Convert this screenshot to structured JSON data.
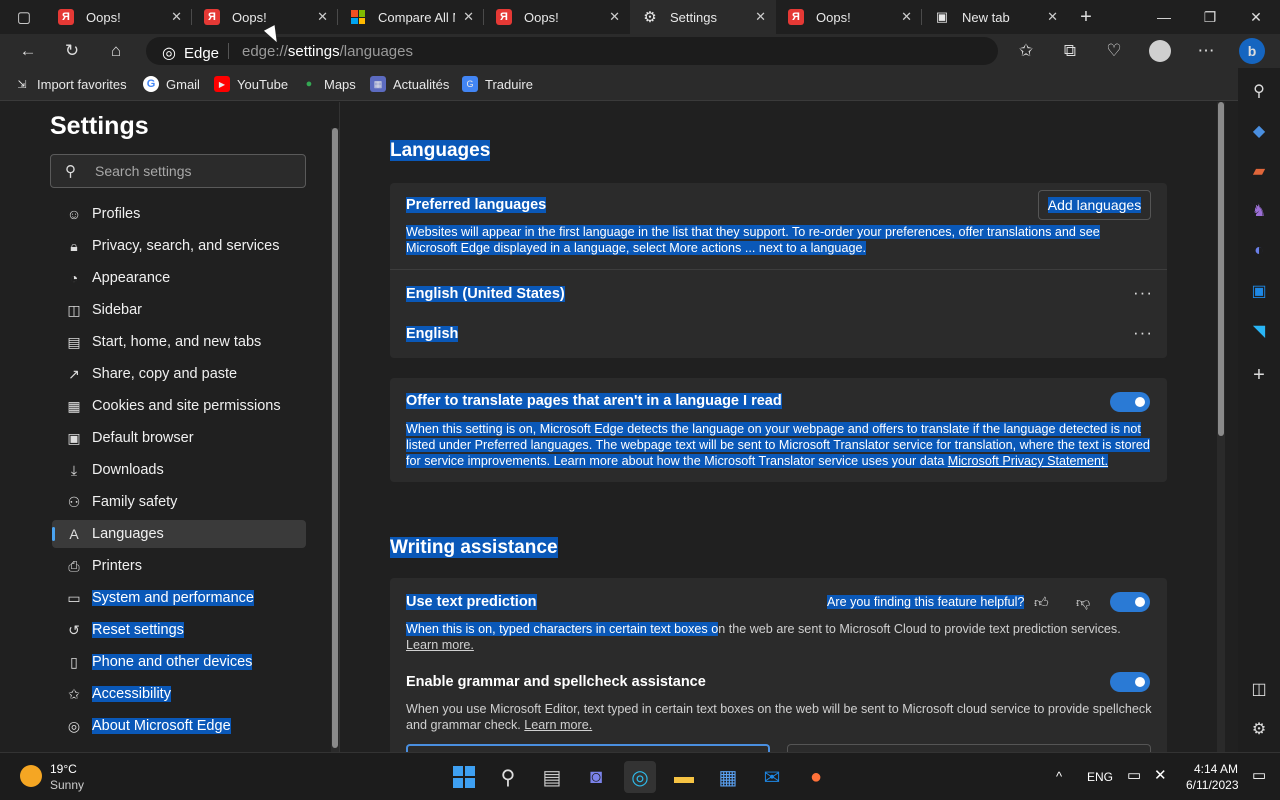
{
  "tabs": [
    {
      "title": "Oops!",
      "favicon": "yandex-icon"
    },
    {
      "title": "Oops!",
      "favicon": "yandex-icon"
    },
    {
      "title": "Compare All M",
      "favicon": "microsoft-icon"
    },
    {
      "title": "Oops!",
      "favicon": "yandex-icon"
    },
    {
      "title": "Settings",
      "favicon": "gear-icon"
    },
    {
      "title": "Oops!",
      "favicon": "yandex-icon"
    },
    {
      "title": "New tab",
      "favicon": "newtab-icon"
    }
  ],
  "address": {
    "browser_label": "Edge",
    "url_prefix": "edge://",
    "url_host": "settings",
    "url_path": "/languages"
  },
  "bookmarks": [
    {
      "label": "Import favorites",
      "icon": "import-icon"
    },
    {
      "label": "Gmail",
      "icon": "google-icon"
    },
    {
      "label": "YouTube",
      "icon": "youtube-icon"
    },
    {
      "label": "Maps",
      "icon": "maps-pin-icon"
    },
    {
      "label": "Actualités",
      "icon": "news-icon"
    },
    {
      "label": "Traduire",
      "icon": "translate-icon"
    }
  ],
  "settings": {
    "title": "Settings",
    "search_placeholder": "Search settings",
    "nav": [
      {
        "label": "Profiles",
        "icon": "profile-icon"
      },
      {
        "label": "Privacy, search, and services",
        "icon": "lock-icon"
      },
      {
        "label": "Appearance",
        "icon": "appearance-icon"
      },
      {
        "label": "Sidebar",
        "icon": "sidebar-icon"
      },
      {
        "label": "Start, home, and new tabs",
        "icon": "home-icon"
      },
      {
        "label": "Share, copy and paste",
        "icon": "share-icon"
      },
      {
        "label": "Cookies and site permissions",
        "icon": "cookies-icon"
      },
      {
        "label": "Default browser",
        "icon": "browser-icon"
      },
      {
        "label": "Downloads",
        "icon": "download-icon"
      },
      {
        "label": "Family safety",
        "icon": "family-icon"
      },
      {
        "label": "Languages",
        "icon": "languages-icon"
      },
      {
        "label": "Printers",
        "icon": "printer-icon"
      },
      {
        "label": "System and performance",
        "icon": "laptop-icon"
      },
      {
        "label": "Reset settings",
        "icon": "reset-icon"
      },
      {
        "label": "Phone and other devices",
        "icon": "phone-icon"
      },
      {
        "label": "Accessibility",
        "icon": "accessibility-icon"
      },
      {
        "label": "About Microsoft Edge",
        "icon": "edge-icon"
      }
    ]
  },
  "main": {
    "languages_heading": "Languages",
    "preferred_label": "Preferred languages",
    "add_languages": "Add languages",
    "preferred_desc": "Websites will appear in the first language in the list that they support. To re-order your preferences, offer translations and see Microsoft Edge displayed in a language, select More actions ... next to a language.",
    "lang_items": [
      "English (United States)",
      "English"
    ],
    "more_actions": "···",
    "translate_label": "Offer to translate pages that aren't in a language I read",
    "translate_desc": "When this setting is on, Microsoft Edge detects the language on your webpage and offers to translate if the language detected is not listed under Preferred languages. The webpage text will be sent to Microsoft Translator service for translation, where the text is stored for service improvements. Learn more about how the Microsoft Translator service uses your data",
    "privacy_link": "Microsoft Privacy Statement.",
    "writing_heading": "Writing assistance",
    "prediction_label": "Use text prediction",
    "feedback_q": "Are you finding this feature helpful?",
    "prediction_desc_a": "When this is on, typed characters in certain text boxes o",
    "prediction_desc_b": "n the web are sent to Microsoft Cloud to provide text prediction services.",
    "learn_more_1": "Learn more.",
    "grammar_label": "Enable grammar and spellcheck assistance",
    "grammar_desc": "When you use Microsoft Editor, text typed in certain text boxes on the web will be sent to Microsoft cloud service to provide spellcheck and grammar check.",
    "learn_more_2": "Learn more."
  },
  "toggles": {
    "translate": true,
    "prediction": true,
    "grammar": true
  },
  "taskbar": {
    "temp": "19°C",
    "condition": "Sunny",
    "lang": "ENG",
    "time": "4:14 AM",
    "date": "6/11/2023"
  },
  "colors": {
    "selection": "#0a58b8",
    "accent": "#2a7ad5",
    "background": "#202020"
  }
}
